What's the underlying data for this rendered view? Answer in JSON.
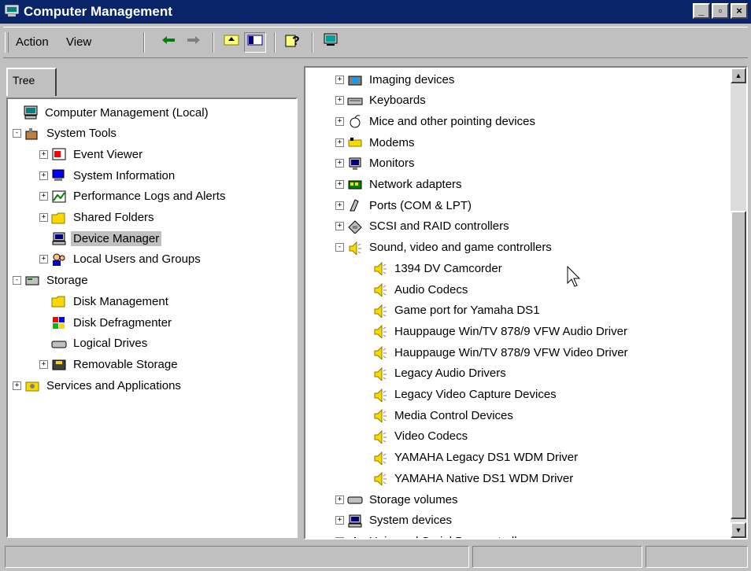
{
  "window": {
    "title": "Computer Management"
  },
  "menu": {
    "action": "Action",
    "view": "View"
  },
  "tabs": {
    "tree": "Tree"
  },
  "left_tree": [
    {
      "label": "Computer Management (Local)",
      "icon": "computer-icon"
    },
    {
      "label": "System Tools",
      "icon": "tools-icon"
    },
    {
      "label": "Event Viewer",
      "icon": "event-viewer-icon"
    },
    {
      "label": "System Information",
      "icon": "system-info-icon"
    },
    {
      "label": "Performance Logs and Alerts",
      "icon": "performance-icon"
    },
    {
      "label": "Shared Folders",
      "icon": "folder-icon"
    },
    {
      "label": "Device Manager",
      "icon": "device-manager-icon",
      "selected": true
    },
    {
      "label": "Local Users and Groups",
      "icon": "users-icon"
    },
    {
      "label": "Storage",
      "icon": "storage-icon"
    },
    {
      "label": "Disk Management",
      "icon": "disk-icon"
    },
    {
      "label": "Disk Defragmenter",
      "icon": "defrag-icon"
    },
    {
      "label": "Logical Drives",
      "icon": "drive-icon"
    },
    {
      "label": "Removable Storage",
      "icon": "removable-storage-icon"
    },
    {
      "label": "Services and Applications",
      "icon": "services-icon"
    }
  ],
  "right_tree": [
    {
      "label": "Imaging devices",
      "icon": "camera-icon"
    },
    {
      "label": "Keyboards",
      "icon": "keyboard-icon"
    },
    {
      "label": "Mice and other pointing devices",
      "icon": "mouse-icon"
    },
    {
      "label": "Modems",
      "icon": "modem-icon"
    },
    {
      "label": "Monitors",
      "icon": "monitor-icon"
    },
    {
      "label": "Network adapters",
      "icon": "network-icon"
    },
    {
      "label": "Ports (COM & LPT)",
      "icon": "port-icon"
    },
    {
      "label": "SCSI and RAID controllers",
      "icon": "scsi-icon"
    },
    {
      "label": "Sound, video and game controllers",
      "icon": "speaker-icon"
    },
    {
      "label": "1394 DV Camcorder",
      "icon": "speaker-icon"
    },
    {
      "label": "Audio Codecs",
      "icon": "speaker-icon"
    },
    {
      "label": "Game port for Yamaha DS1",
      "icon": "speaker-icon"
    },
    {
      "label": "Hauppauge Win/TV 878/9 VFW Audio Driver",
      "icon": "speaker-icon"
    },
    {
      "label": "Hauppauge Win/TV 878/9 VFW Video Driver",
      "icon": "speaker-icon"
    },
    {
      "label": "Legacy Audio Drivers",
      "icon": "speaker-icon"
    },
    {
      "label": "Legacy Video Capture Devices",
      "icon": "speaker-icon"
    },
    {
      "label": "Media Control Devices",
      "icon": "speaker-icon"
    },
    {
      "label": "Video Codecs",
      "icon": "speaker-icon"
    },
    {
      "label": "YAMAHA Legacy DS1 WDM Driver",
      "icon": "speaker-icon"
    },
    {
      "label": "YAMAHA Native DS1 WDM Driver",
      "icon": "speaker-icon"
    },
    {
      "label": "Storage volumes",
      "icon": "storage-volume-icon"
    },
    {
      "label": "System devices",
      "icon": "system-device-icon"
    },
    {
      "label": "Universal Serial Bus controllers",
      "icon": "usb-icon"
    }
  ],
  "colors": {
    "titlebar": "#0a246a",
    "face": "#c0c0c0"
  }
}
